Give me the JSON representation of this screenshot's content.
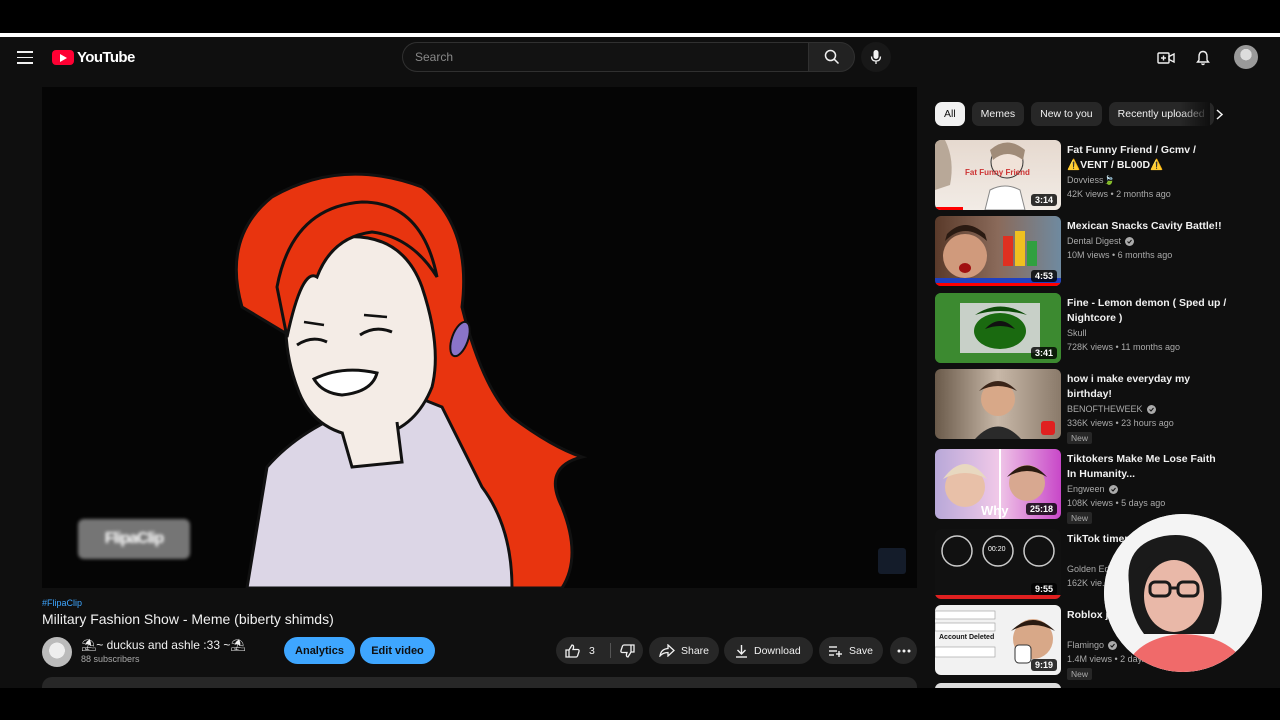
{
  "header": {
    "logo_text": "YouTube",
    "search_placeholder": "Search"
  },
  "video": {
    "hashtag": "#FlipaClip",
    "title": "Military Fashion Show - Meme (biberty shimds)",
    "watermark_text": "FlipaClip",
    "channel_name": "⛱~ duckus and ashle :33 ~⛱",
    "subscribers": "88 subscribers",
    "analytics_label": "Analytics",
    "edit_label": "Edit video",
    "like_count": "3",
    "share_label": "Share",
    "download_label": "Download",
    "save_label": "Save"
  },
  "chips": [
    "All",
    "Memes",
    "New to you",
    "Recently uploaded"
  ],
  "recommendations": [
    {
      "title": "Fat Funny Friend / Gcmv / ⚠️VENT / BL00D⚠️",
      "channel": "Dovviess🍃",
      "verified": false,
      "meta": "42K views  • 2 months ago",
      "duration": "3:14",
      "badge": "",
      "thumb_text": "Fat Funny Friend"
    },
    {
      "title": "Mexican Snacks Cavity Battle!!",
      "channel": "Dental Digest",
      "verified": true,
      "meta": "10M views  • 6 months ago",
      "duration": "4:53",
      "badge": "",
      "thumb_text": ""
    },
    {
      "title": "Fine - Lemon demon ( Sped up / Nightcore )",
      "channel": "Skull",
      "verified": false,
      "meta": "728K views  • 11 months ago",
      "duration": "3:41",
      "badge": "",
      "thumb_text": ""
    },
    {
      "title": "how i make everyday my birthday!",
      "channel": "BENOFTHEWEEK",
      "verified": true,
      "meta": "336K views  • 23 hours ago",
      "duration": "",
      "badge": "New",
      "thumb_text": ""
    },
    {
      "title": "Tiktokers Make Me Lose Faith In Humanity...",
      "channel": "Engween",
      "verified": true,
      "meta": "108K views  • 5 days ago",
      "duration": "25:18",
      "badge": "New",
      "thumb_text": "Why"
    },
    {
      "title": "TikTok timer P... your wall a...",
      "channel": "Golden Ed...",
      "verified": false,
      "meta": "162K vie...",
      "duration": "9:55",
      "badge": "",
      "thumb_text": "00:20"
    },
    {
      "title": "Roblox ju... accounts",
      "channel": "Flamingo",
      "verified": true,
      "meta": "1.4M views  • 2 day...",
      "duration": "9:19",
      "badge": "New",
      "thumb_text": "Account Deleted"
    }
  ],
  "colors": {
    "background": "#0f0f0f",
    "accent_blue": "#3ea6ff",
    "brand_red": "#ff0033",
    "chip_bg": "#272727"
  }
}
